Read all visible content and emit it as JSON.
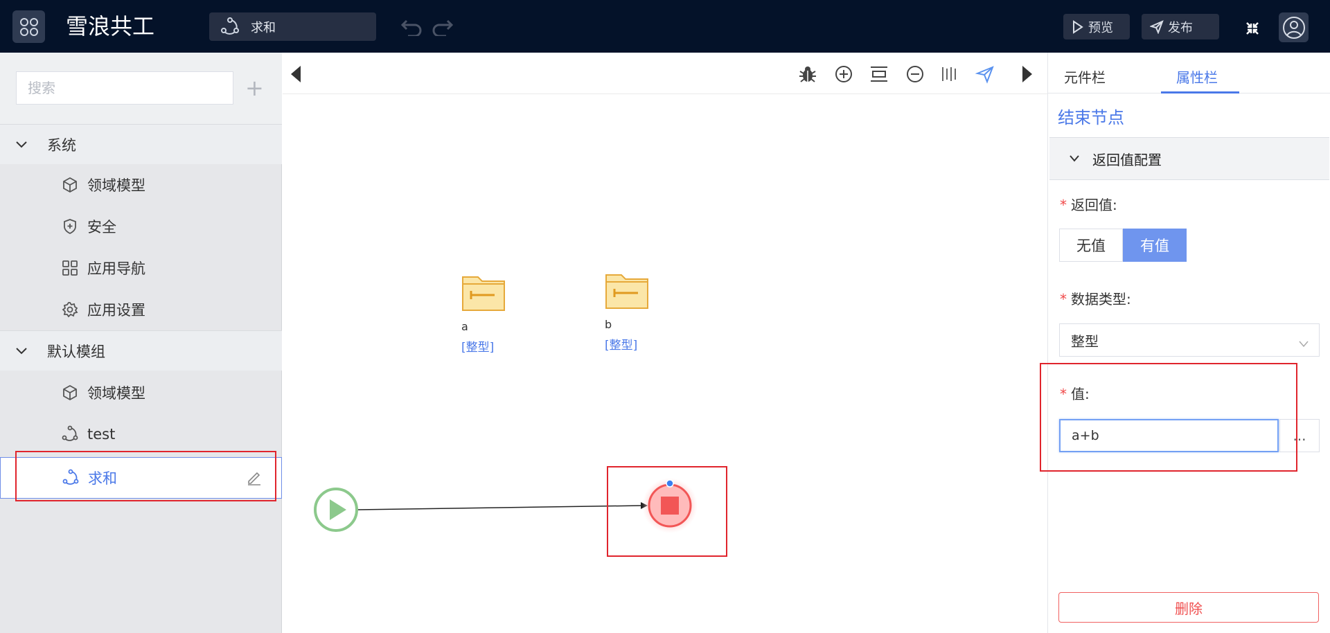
{
  "header": {
    "app_title": "雪浪共工",
    "current_flow": "求和",
    "preview_label": "预览",
    "publish_label": "发布"
  },
  "sidebar": {
    "search_placeholder": "搜索",
    "groups": [
      {
        "label": "系统",
        "items": [
          {
            "label": "领域模型",
            "icon": "cube-icon"
          },
          {
            "label": "安全",
            "icon": "shield-plus-icon"
          },
          {
            "label": "应用导航",
            "icon": "grid-icon"
          },
          {
            "label": "应用设置",
            "icon": "gear-icon"
          }
        ]
      },
      {
        "label": "默认模组",
        "items": [
          {
            "label": "领域模型",
            "icon": "cube-icon"
          },
          {
            "label": "test",
            "icon": "flow-icon"
          },
          {
            "label": "求和",
            "icon": "flow-icon",
            "active": true
          }
        ]
      }
    ]
  },
  "canvas": {
    "variables": [
      {
        "name": "a",
        "type": "[整型]"
      },
      {
        "name": "b",
        "type": "[整型]"
      }
    ],
    "nodes": [
      "start-node",
      "end-node"
    ]
  },
  "panel": {
    "tabs": [
      "元件栏",
      "属性栏"
    ],
    "active_tab": "属性栏",
    "title": "结束节点",
    "section_title": "返回值配置",
    "return_label": "返回值:",
    "return_options": [
      "无值",
      "有值"
    ],
    "return_selected": "有值",
    "datatype_label": "数据类型:",
    "datatype_value": "整型",
    "value_label": "值:",
    "value": "a+b",
    "more_label": "...",
    "delete_label": "删除"
  },
  "colors": {
    "topbar": "#041229",
    "accent": "#4a78e8",
    "highlight_box": "#e0242c",
    "start_node": "#8cc98c",
    "end_node": "#f25656"
  }
}
